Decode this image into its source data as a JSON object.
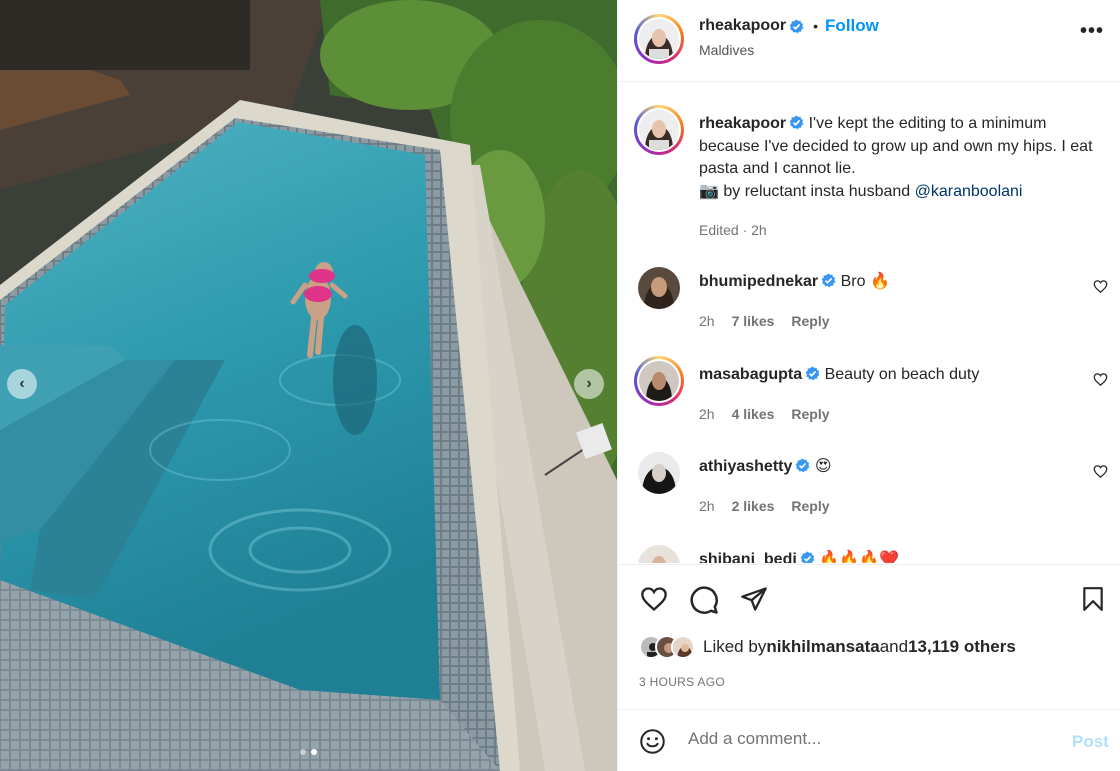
{
  "post": {
    "username": "rheakapoor",
    "separator": "•",
    "follow_label": "Follow",
    "location": "Maldives",
    "more_label": "•••"
  },
  "caption": {
    "username": "rheakapoor",
    "text": "I've kept the editing to a minimum because I've decided to grow up and own my hips. I eat pasta and I cannot lie.",
    "camera_emoji": "📷",
    "credit_prefix": " by reluctant insta husband ",
    "mention": "@karanboolani",
    "edited": "Edited · 2h"
  },
  "comments": [
    {
      "username": "bhumipednekar",
      "text": "Bro",
      "emoji": "🔥",
      "time": "2h",
      "likes": "7 likes",
      "reply": "Reply"
    },
    {
      "username": "masabagupta",
      "text": "Beauty on beach duty",
      "emoji": "",
      "time": "2h",
      "likes": "4 likes",
      "reply": "Reply"
    },
    {
      "username": "athiyashetty",
      "text": "",
      "emoji": "😍",
      "time": "2h",
      "likes": "2 likes",
      "reply": "Reply"
    },
    {
      "username": "shibani_bedi",
      "text": "",
      "emoji": "🔥🔥🔥❤️",
      "time": "",
      "likes": "",
      "reply": ""
    }
  ],
  "likes": {
    "prefix": "Liked by ",
    "user": "nikhilmansata",
    "mid": " and ",
    "count": "13,119 others"
  },
  "timestamp": "3 HOURS AGO",
  "comment_box": {
    "placeholder": "Add a comment...",
    "post_label": "Post"
  },
  "carousel": {
    "prev": "‹",
    "next": "›",
    "slide_count": 2,
    "active_slide": 1
  },
  "colors": {
    "link_blue": "#0095f6",
    "verified_blue": "#3897f0",
    "mention": "#00376b",
    "post_disabled": "#b2dffc"
  },
  "icons": [
    "heart-icon",
    "comment-icon",
    "share-icon",
    "bookmark-icon",
    "emoji-icon",
    "verified-badge-icon",
    "more-icon",
    "chevron-left-icon",
    "chevron-right-icon"
  ]
}
